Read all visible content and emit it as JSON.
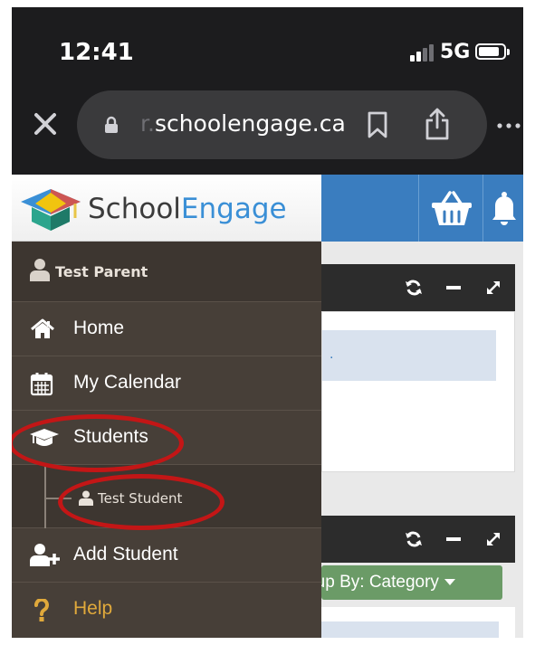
{
  "status_bar": {
    "time": "12:41",
    "network": "5G",
    "battery_level": 0.85
  },
  "browser": {
    "url_prefix": "r.",
    "url_domain": "schoolengage.ca",
    "icons": {
      "close": "close-icon",
      "lock": "lock-icon",
      "bookmark": "bookmark-icon",
      "share": "share-icon",
      "more": "more-icon"
    }
  },
  "site": {
    "logo_part1": "School",
    "logo_part2": "Engage",
    "colors": {
      "header": "#3a7dbf",
      "logo_blue": "#3a8fd6",
      "sidebar": "#473f38",
      "annotation": "#c31616",
      "help": "#e0a93b",
      "group_button": "#6b9b67"
    }
  },
  "sidebar": {
    "user_name": "Test Parent",
    "items": [
      {
        "label": "Home",
        "icon": "home-icon"
      },
      {
        "label": "My Calendar",
        "icon": "calendar-icon"
      },
      {
        "label": "Students",
        "icon": "graduation-cap-icon"
      },
      {
        "label": "Test Student",
        "icon": "user-icon"
      },
      {
        "label": "Add Student",
        "icon": "add-user-icon"
      },
      {
        "label": "Help",
        "icon": "question-icon"
      }
    ]
  },
  "content": {
    "notice_text": ".",
    "group_by_label": "Group By: Category",
    "widget_icons": [
      "refresh-icon",
      "minimize-icon",
      "expand-icon"
    ]
  }
}
